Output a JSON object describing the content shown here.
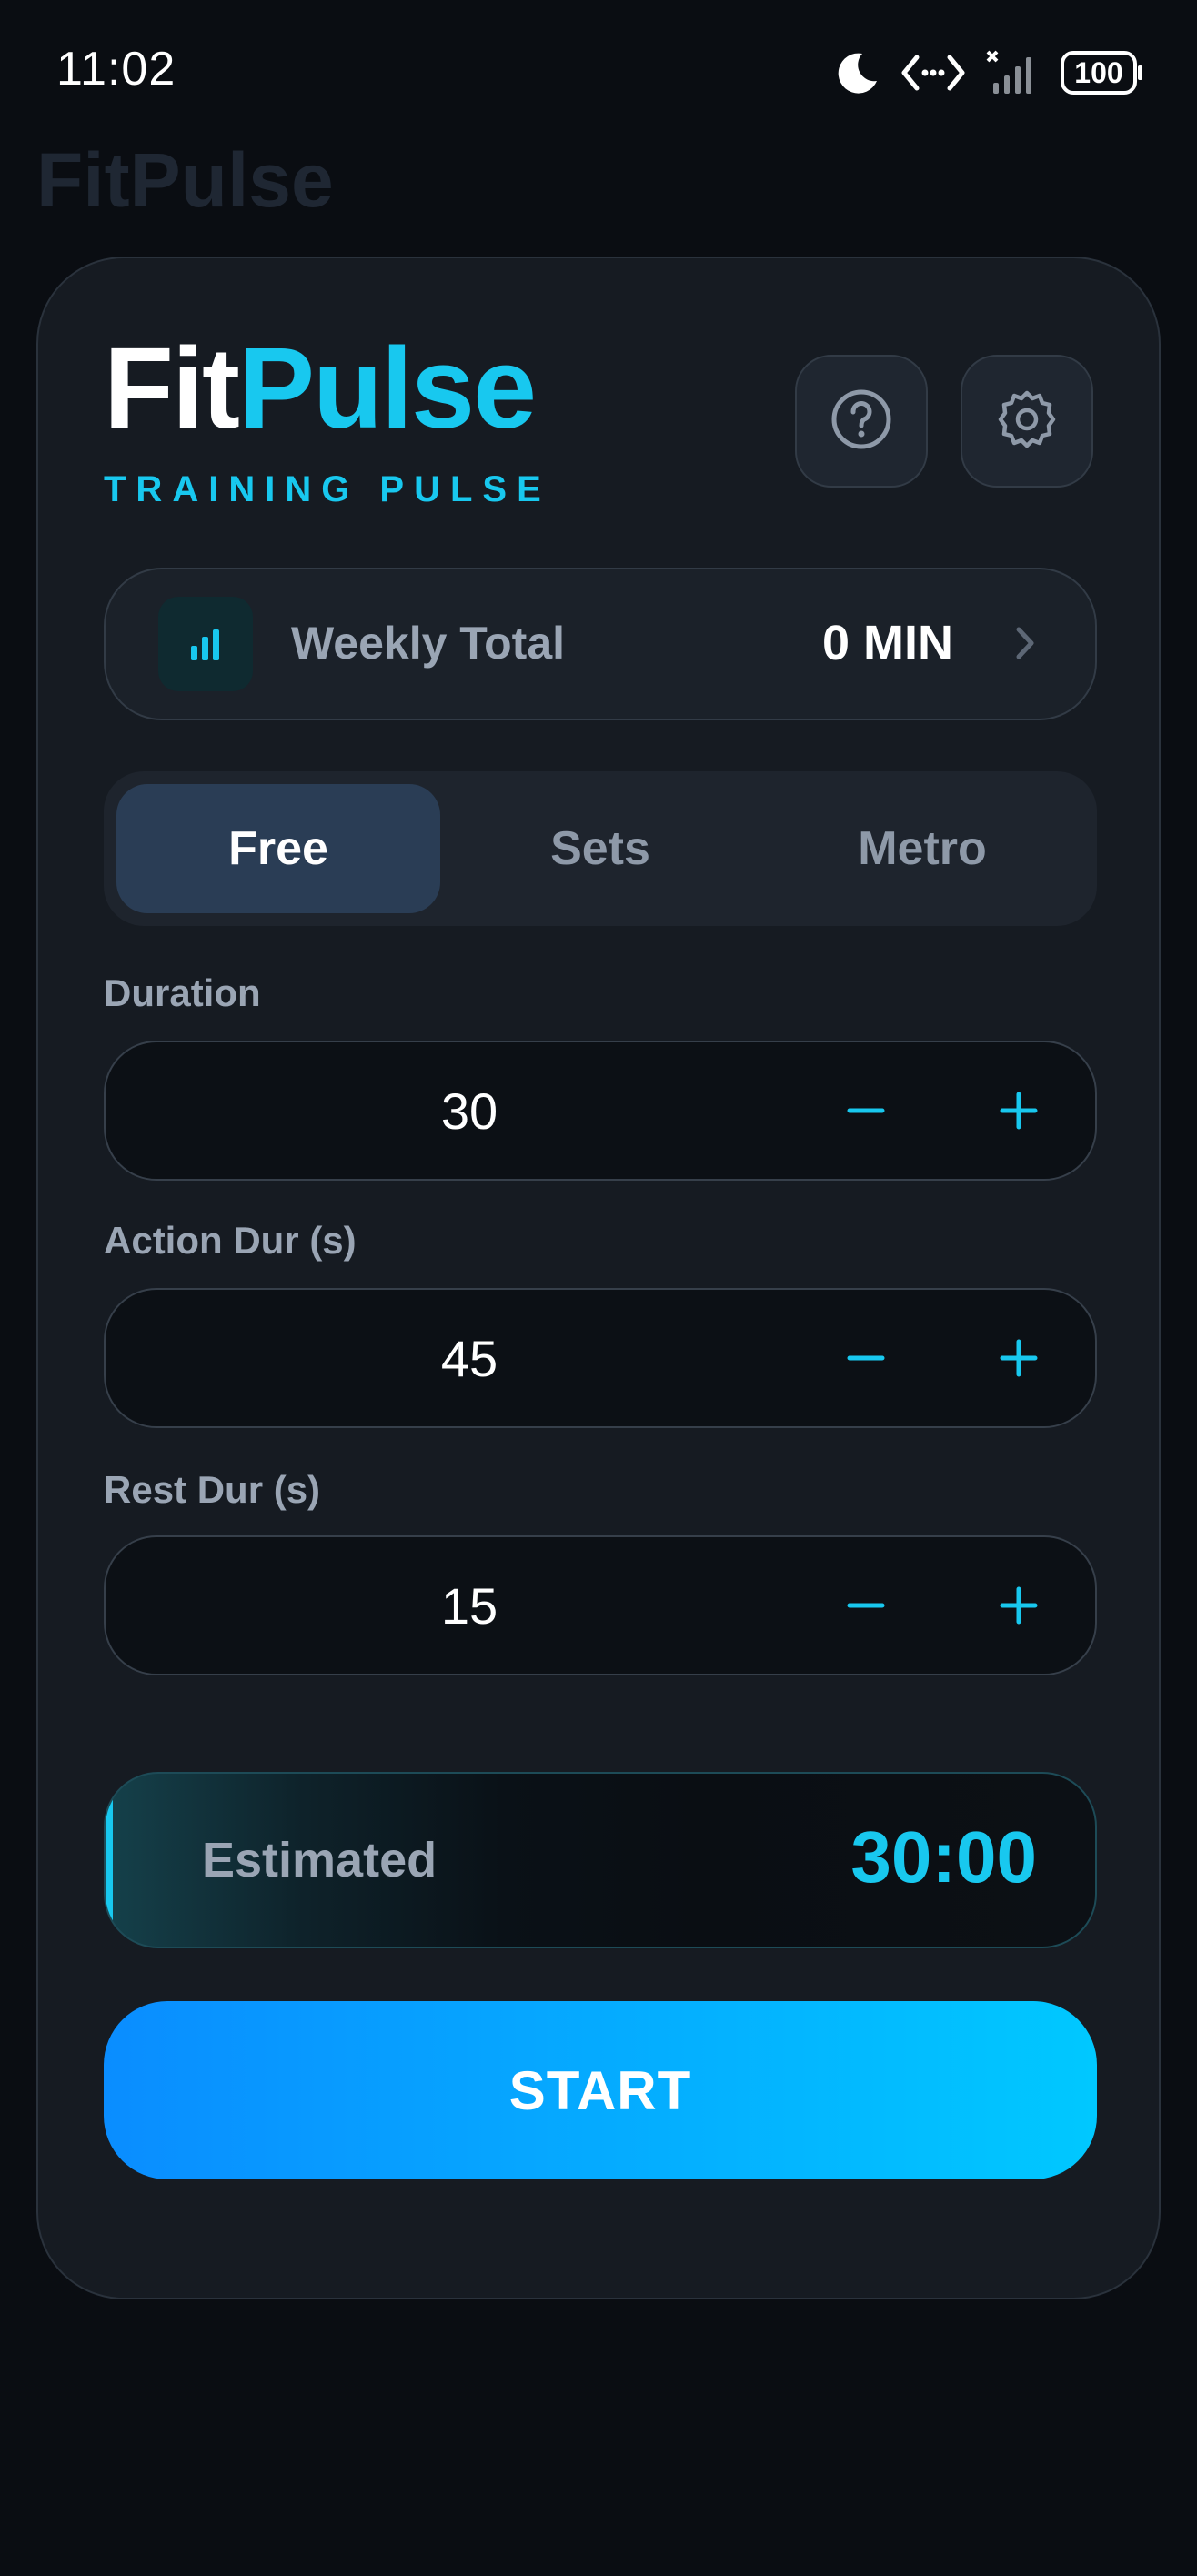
{
  "status_bar": {
    "time": "11:02",
    "battery": "100",
    "icons": [
      "moon-icon",
      "network-arrows-icon",
      "signal-icon",
      "battery-icon"
    ]
  },
  "background_title": "FitPulse",
  "brand": {
    "name_part1": "Fit",
    "name_part2": "Pulse",
    "subtitle": "TRAINING PULSE"
  },
  "header_buttons": {
    "help_icon": "help-circle-icon",
    "settings_icon": "gear-icon"
  },
  "weekly": {
    "label": "Weekly Total",
    "value": "0 MIN",
    "icon": "bar-chart-icon"
  },
  "tabs": [
    {
      "label": "Free",
      "active": true
    },
    {
      "label": "Sets",
      "active": false
    },
    {
      "label": "Metro",
      "active": false
    }
  ],
  "fields": [
    {
      "label": "Duration",
      "value": "30"
    },
    {
      "label": "Action Dur (s)",
      "value": "45"
    },
    {
      "label": "Rest Dur (s)",
      "value": "15"
    }
  ],
  "estimate": {
    "label": "Estimated",
    "value": "30:00"
  },
  "start_label": "START",
  "colors": {
    "accent": "#18c8ef",
    "background": "#0a0d12",
    "card": "#161b22",
    "start_gradient_from": "#0a8dff",
    "start_gradient_to": "#00c8ff"
  }
}
